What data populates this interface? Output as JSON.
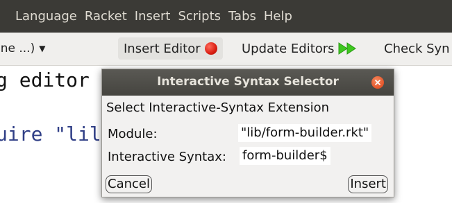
{
  "menubar": {
    "items": [
      "Language",
      "Racket",
      "Insert",
      "Scripts",
      "Tabs",
      "Help"
    ]
  },
  "toolbar": {
    "language_dropdown": "ine ...)",
    "insert_editor": "Insert Editor",
    "update_editors": "Update Editors",
    "check_syntax": "Check Syn"
  },
  "editor": {
    "lines": [
      "g editor",
      "uire \"lil"
    ]
  },
  "dialog": {
    "title": "Interactive Syntax Selector",
    "heading": "Select Interactive-Syntax Extension",
    "module_label": "Module:",
    "module_value": "\"lib/form-builder.rkt\"",
    "syntax_label": "Interactive Syntax:",
    "syntax_value": "form-builder$",
    "cancel_label": "Cancel",
    "ok_label": "Insert"
  },
  "colors": {
    "menubar_bg": "#3b3a36",
    "titlebar_bg": "#4f4e4a",
    "close_button": "#e4552a",
    "record_dot": "#e0241a",
    "arrows": "#3ec71f",
    "string_color": "#2f3e86"
  }
}
